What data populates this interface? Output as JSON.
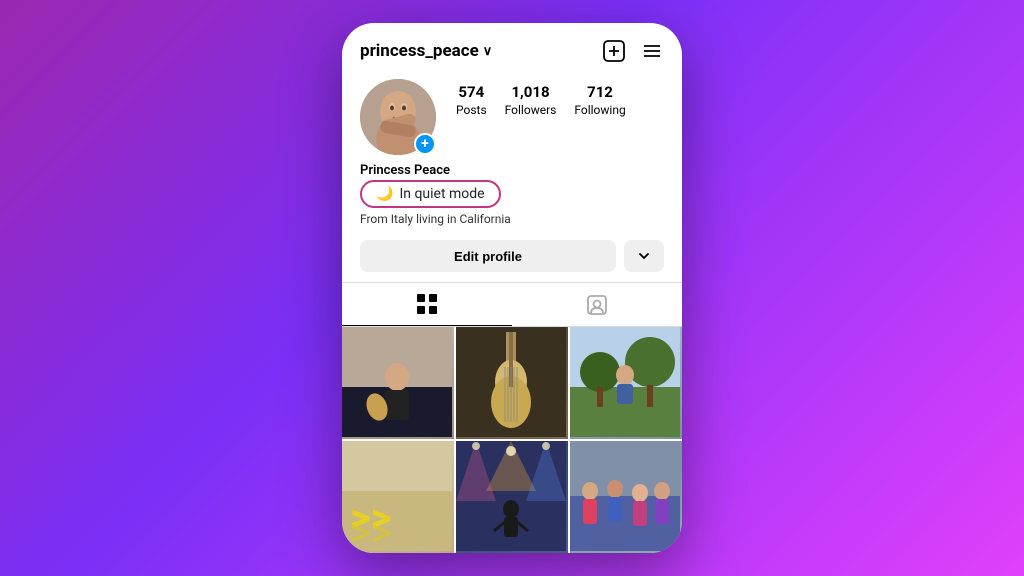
{
  "background": {
    "gradient": "purple to magenta"
  },
  "header": {
    "username": "princess_peace",
    "chevron": "∨",
    "add_icon_label": "new-post-icon",
    "menu_icon_label": "menu-icon"
  },
  "profile": {
    "avatar_alt": "Profile photo of princess_peace",
    "stats": {
      "posts_count": "574",
      "posts_label": "Posts",
      "followers_count": "1,018",
      "followers_label": "Followers",
      "following_count": "712",
      "following_label": "Following"
    },
    "add_story_label": "+"
  },
  "bio": {
    "display_name": "Princess Peace",
    "quiet_mode_text": "In quiet mode",
    "location": "From Italy living in California"
  },
  "actions": {
    "edit_profile_label": "Edit profile",
    "dropdown_label": "▾"
  },
  "tabs": {
    "grid_tab_label": "grid-icon",
    "tagged_tab_label": "tagged-icon"
  },
  "photos": {
    "cells": [
      {
        "id": "cell-1",
        "alt": "photo 1"
      },
      {
        "id": "cell-2",
        "alt": "photo 2"
      },
      {
        "id": "cell-3",
        "alt": "photo 3"
      },
      {
        "id": "cell-4",
        "alt": "photo 4"
      },
      {
        "id": "cell-5",
        "alt": "photo 5"
      },
      {
        "id": "cell-6",
        "alt": "photo 6"
      }
    ]
  }
}
